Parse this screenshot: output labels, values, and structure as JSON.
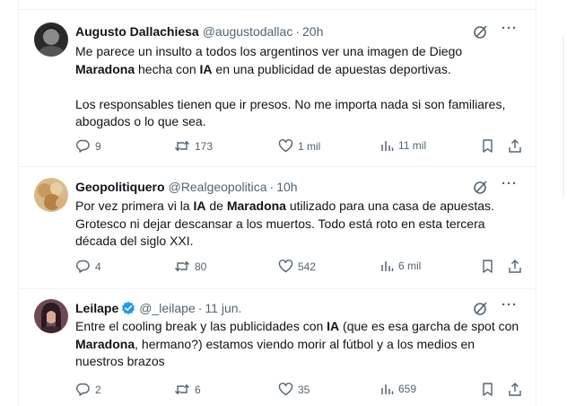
{
  "tweets": [
    {
      "name": "Augusto Dallachiesa",
      "handle": "@augustodallac",
      "separator": "·",
      "time": "20h",
      "verified": false,
      "paragraphs": [
        [
          {
            "t": "Me parece un insulto a todos los argentinos ver una imagen de Diego "
          },
          {
            "t": "Maradona",
            "b": true
          },
          {
            "t": " hecha con "
          },
          {
            "t": "IA",
            "b": true
          },
          {
            "t": " en una publicidad de apuestas deportivas."
          }
        ],
        [
          {
            "t": "Los responsables tienen que ir presos. No me importa nada si son familiares, abogados o lo que sea."
          }
        ]
      ],
      "replies": "9",
      "reposts": "173",
      "likes": "1 mil",
      "views": "11 mil"
    },
    {
      "name": "Geopolitiquero",
      "handle": "@Realgeopolitica",
      "separator": "·",
      "time": "10h",
      "verified": false,
      "paragraphs": [
        [
          {
            "t": "Por vez primera vi la "
          },
          {
            "t": "IA",
            "b": true
          },
          {
            "t": " de "
          },
          {
            "t": "Maradona",
            "b": true
          },
          {
            "t": " utilizado para una casa de apuestas. Grotesco ni dejar descansar a los muertos. Todo está roto en esta tercera década del siglo XXI."
          }
        ]
      ],
      "replies": "4",
      "reposts": "80",
      "likes": "542",
      "views": "6 mil"
    },
    {
      "name": "Leilape",
      "handle": "@_leilape",
      "separator": "·",
      "time": "11 jun.",
      "verified": true,
      "paragraphs": [
        [
          {
            "t": "Entre el cooling break y las publicidades con "
          },
          {
            "t": "IA",
            "b": true
          },
          {
            "t": " (que es esa garcha de spot con "
          },
          {
            "t": "Maradona",
            "b": true
          },
          {
            "t": ", hermano?) estamos viendo morir al fútbol y a los medios en nuestros brazos"
          }
        ]
      ],
      "replies": "2",
      "reposts": "6",
      "likes": "35",
      "views": "659"
    }
  ],
  "colors": {
    "text": "#0f1419",
    "secondary": "#536471",
    "verified": "#1d9bf0",
    "border": "#eff3f4"
  },
  "icons": [
    "grok-icon",
    "more-icon",
    "reply-icon",
    "repost-icon",
    "like-icon",
    "views-icon",
    "bookmark-icon",
    "share-icon",
    "verified-badge-icon"
  ]
}
